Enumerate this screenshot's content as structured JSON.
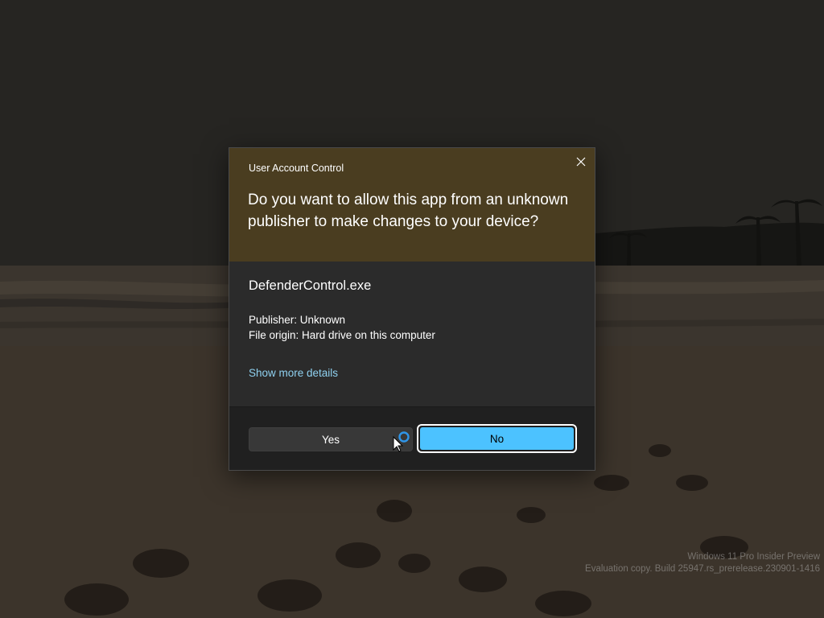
{
  "dialog": {
    "title": "User Account Control",
    "prompt": "Do you want to allow this app from an unknown publisher to make changes to your device?",
    "app_name": "DefenderControl.exe",
    "publisher": "Publisher: Unknown",
    "file_origin": "File origin: Hard drive on this computer",
    "details_link": "Show more details",
    "yes_label": "Yes",
    "no_label": "No",
    "close_icon": "close-icon"
  },
  "watermark": {
    "line1": "Windows 11 Pro Insider Preview",
    "line2": "Evaluation copy. Build 25947.rs_prerelease.230901-1416"
  },
  "colors": {
    "header_bg": "#4a3d20",
    "body_bg": "#2b2b2b",
    "footer_bg": "#202020",
    "accent": "#4cc2ff",
    "link": "#8fd1f0"
  },
  "icons": [
    "close-icon",
    "busy-cursor-icon"
  ]
}
